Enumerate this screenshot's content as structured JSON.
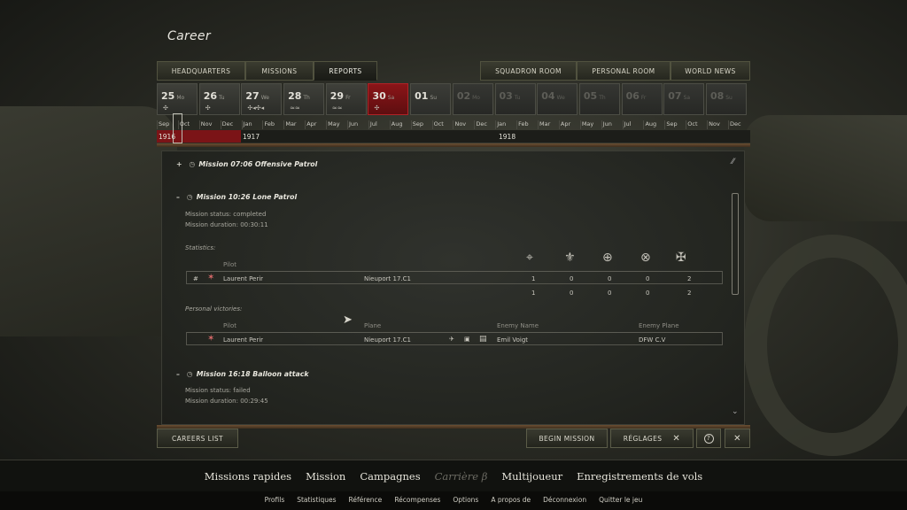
{
  "title": "Career",
  "tabs_left": [
    {
      "label": "HEADQUARTERS",
      "active": false
    },
    {
      "label": "MISSIONS",
      "active": false
    },
    {
      "label": "REPORTS",
      "active": true
    }
  ],
  "tabs_right": [
    {
      "label": "SQUADRON ROOM"
    },
    {
      "label": "PERSONAL ROOM"
    },
    {
      "label": "WORLD NEWS"
    }
  ],
  "days": [
    {
      "num": "25",
      "wd": "Mo",
      "mark": "✣",
      "state": "past"
    },
    {
      "num": "26",
      "wd": "Tu",
      "mark": "✣",
      "state": "past"
    },
    {
      "num": "27",
      "wd": "We",
      "mark": "✣◂✣◂",
      "state": "past"
    },
    {
      "num": "28",
      "wd": "Th",
      "mark": "≈≈",
      "state": "past"
    },
    {
      "num": "29",
      "wd": "Fr",
      "mark": "≈≈",
      "state": "past"
    },
    {
      "num": "30",
      "wd": "Sa",
      "mark": "✣",
      "state": "sel"
    },
    {
      "num": "01",
      "wd": "Su",
      "mark": "",
      "state": "next"
    },
    {
      "num": "02",
      "wd": "Mo",
      "mark": "",
      "state": "future"
    },
    {
      "num": "03",
      "wd": "Tu",
      "mark": "",
      "state": "future"
    },
    {
      "num": "04",
      "wd": "We",
      "mark": "",
      "state": "future"
    },
    {
      "num": "05",
      "wd": "Th",
      "mark": "",
      "state": "future"
    },
    {
      "num": "06",
      "wd": "Fr",
      "mark": "",
      "state": "future"
    },
    {
      "num": "07",
      "wd": "Sa",
      "mark": "",
      "state": "future"
    },
    {
      "num": "08",
      "wd": "Su",
      "mark": "",
      "state": "future"
    }
  ],
  "months": [
    "Sep",
    "Oct",
    "Nov",
    "Dec",
    "Jan",
    "Feb",
    "Mar",
    "Apr",
    "May",
    "Jun",
    "Jul",
    "Aug",
    "Sep",
    "Oct",
    "Nov",
    "Dec",
    "Jan",
    "Feb",
    "Mar",
    "Apr",
    "May",
    "Jun",
    "Jul",
    "Aug",
    "Sep",
    "Oct",
    "Nov",
    "Dec"
  ],
  "years": [
    "1916",
    "1917",
    "1918"
  ],
  "missions": {
    "m1": {
      "toggle": "+",
      "title": "Mission 07:06 Offensive Patrol"
    },
    "m2": {
      "toggle": "–",
      "title": "Mission 10:26 Lone Patrol",
      "status": "Mission status: completed",
      "duration": "Mission duration: 00:30:11",
      "stats_label": "Statistics:",
      "pilot_col": "Pilot",
      "row": {
        "rank": "#",
        "pilot": "Laurent Perir",
        "plane": "Nieuport 17.C1",
        "values": [
          "1",
          "0",
          "0",
          "0",
          "2"
        ]
      },
      "totals": [
        "1",
        "0",
        "0",
        "0",
        "2"
      ],
      "victories_label": "Personal victories:",
      "vcols": {
        "pilot": "Pilot",
        "plane": "Plane",
        "enemy": "Enemy Name",
        "enemy_plane": "Enemy Plane"
      },
      "victory": {
        "pilot": "Laurent Perir",
        "plane": "Nieuport 17.C1",
        "enemy": "Emil Voigt",
        "enemy_plane": "DFW C.V"
      }
    },
    "m3": {
      "toggle": "–",
      "title": "Mission 16:18 Balloon attack",
      "status": "Mission status: failed",
      "duration": "Mission duration: 00:29:45"
    }
  },
  "bottom": {
    "careers_list": "CAREERS LIST",
    "begin_mission": "BEGIN MISSION",
    "settings": "RÉGLAGES",
    "settings_icon": "✕",
    "help_icon": "?",
    "close_icon": "✕"
  },
  "nav_main": [
    "Missions rapides",
    "Mission",
    "Campagnes",
    "Carrière β",
    "Multijoueur",
    "Enregistrements de vols"
  ],
  "nav_sub": [
    "Profils",
    "Statistiques",
    "Référence",
    "Récompenses",
    "Options",
    "A propos de",
    "Déconnexion",
    "Quitter le jeu"
  ]
}
